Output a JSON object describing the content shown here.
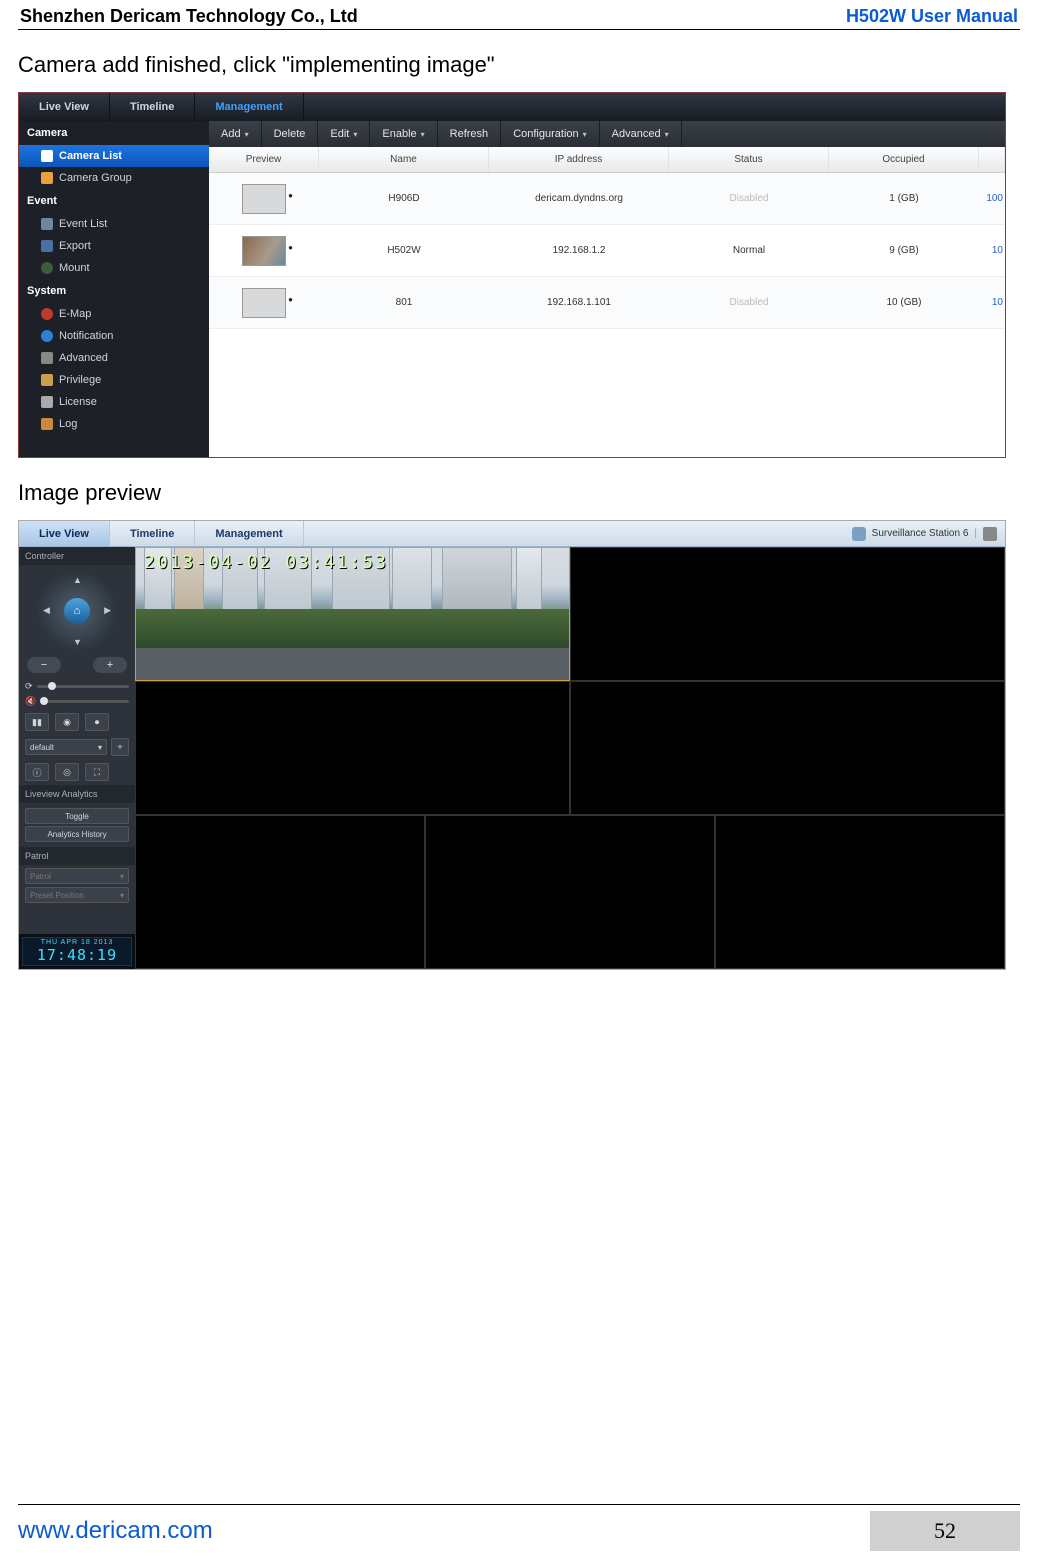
{
  "doc": {
    "company": "Shenzhen Dericam Technology Co., Ltd",
    "manual_title": "H502W User Manual",
    "text1": "Camera add finished, click \"implementing image\"",
    "text2": "Image preview",
    "footer_url": "www.dericam.com",
    "page_num": "52"
  },
  "ss1": {
    "tabs": {
      "live": "Live View",
      "timeline": "Timeline",
      "management": "Management"
    },
    "sidebar": {
      "camera": "Camera",
      "items_camera": [
        "Camera List",
        "Camera Group"
      ],
      "event": "Event",
      "items_event": [
        "Event List",
        "Export",
        "Mount"
      ],
      "system": "System",
      "items_system": [
        "E-Map",
        "Notification",
        "Advanced",
        "Privilege",
        "License",
        "Log"
      ]
    },
    "toolbar": [
      "Add",
      "Delete",
      "Edit",
      "Enable",
      "Refresh",
      "Configuration",
      "Advanced"
    ],
    "columns": {
      "preview": "Preview",
      "name": "Name",
      "ip": "IP address",
      "status": "Status",
      "occupied": "Occupied",
      "rest": ""
    },
    "rows": [
      {
        "name": "H906D",
        "ip": "dericam.dyndns.org",
        "status": "Disabled",
        "occupied": "1 (GB)",
        "rest": "100",
        "thumb": "off"
      },
      {
        "name": "H502W",
        "ip": "192.168.1.2",
        "status": "Normal",
        "occupied": "9 (GB)",
        "rest": "10",
        "thumb": "live"
      },
      {
        "name": "801",
        "ip": "192.168.1.101",
        "status": "Disabled",
        "occupied": "10 (GB)",
        "rest": "10",
        "thumb": "off"
      }
    ]
  },
  "ss2": {
    "tabs": {
      "live": "Live View",
      "timeline": "Timeline",
      "management": "Management"
    },
    "right_label": "Surveillance Station 6",
    "sections": {
      "controller": "Controller",
      "analytics": "Liveview Analytics",
      "patrol": "Patrol"
    },
    "ptz_home": "⌂",
    "zoom_minus": "−",
    "zoom_plus": "+",
    "buttons": {
      "pause": "▮▮",
      "snapshot": "◉",
      "rec": "⏺"
    },
    "default_label": "default",
    "default_arrow": "▾",
    "icons3": [
      "ⓘ",
      "◎",
      "⛶"
    ],
    "toggle_label": "Toggle",
    "history_label": "Analytics History",
    "patrol_dd1": "Patrol",
    "patrol_dd2": "Preset Position",
    "clock_date": "THU APR 18 2013",
    "clock_time": "17:48:19",
    "video_timestamp": "2013-04-02 03:41:53"
  }
}
